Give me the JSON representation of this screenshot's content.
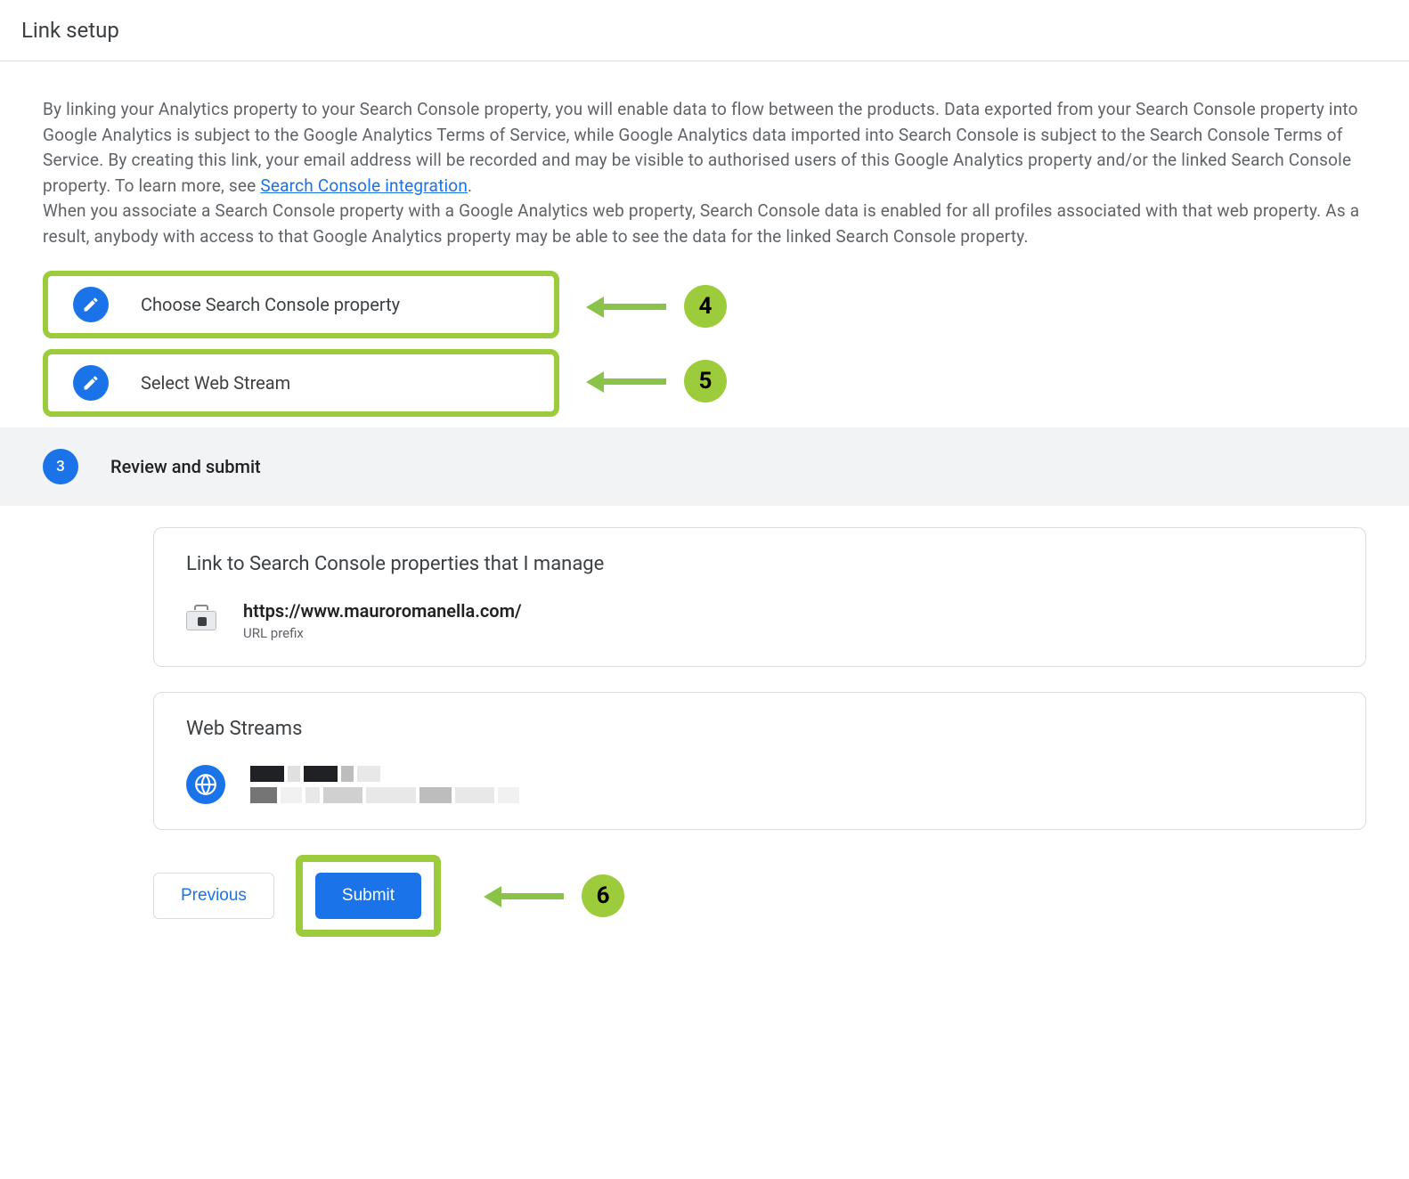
{
  "header": {
    "title": "Link setup"
  },
  "intro": {
    "paragraph1_part1": "By linking your Analytics property to your Search Console property, you will enable data to flow between the products. Data exported from your Search Console property into Google Analytics is subject to the Google Analytics Terms of Service, while Google Analytics data imported into Search Console is subject to the Search Console Terms of Service. By creating this link, your email address will be recorded and may be visible to authorised users of this Google Analytics property and/or the linked Search Console property. To learn more, see ",
    "link_text": "Search Console integration",
    "paragraph1_part2": ".",
    "paragraph2": "When you associate a Search Console property with a Google Analytics web property, Search Console data is enabled for all profiles associated with that web property. As a result, anybody with access to that Google Analytics property may be able to see the data for the linked Search Console property."
  },
  "steps": {
    "step1": {
      "label": "Choose Search Console property"
    },
    "step2": {
      "label": "Select Web Stream"
    },
    "step3": {
      "number": "3",
      "label": "Review and submit"
    }
  },
  "annotations": {
    "badge4": "4",
    "badge5": "5",
    "badge6": "6"
  },
  "review": {
    "console_card_title": "Link to Search Console properties that I manage",
    "property_url": "https://www.mauroromanella.com/",
    "property_type": "URL prefix",
    "webstreams_title": "Web Streams"
  },
  "buttons": {
    "previous": "Previous",
    "submit": "Submit"
  }
}
